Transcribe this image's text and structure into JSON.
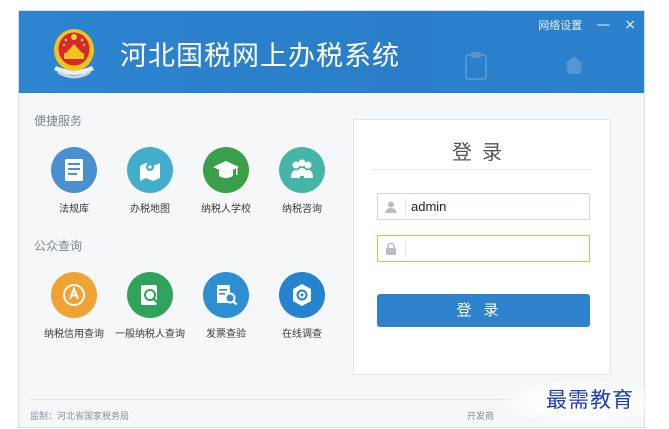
{
  "header": {
    "title": "河北国税网上办税系统",
    "network_settings": "网络设置",
    "minimize": "—",
    "close": "×"
  },
  "sections": {
    "convenience": {
      "title": "便捷服务",
      "items": [
        {
          "label": "法规库",
          "icon": "book-icon",
          "color": "#4a90cf"
        },
        {
          "label": "办税地图",
          "icon": "map-icon",
          "color": "#41aecb"
        },
        {
          "label": "纳税人学校",
          "icon": "graduation-cap-icon",
          "color": "#3b9e49"
        },
        {
          "label": "纳税咨询",
          "icon": "people-consult-icon",
          "color": "#45b6a6"
        }
      ]
    },
    "public_query": {
      "title": "公众查询",
      "items": [
        {
          "label": "纳税信用查询",
          "icon": "credit-badge-icon",
          "color": "#f0a233"
        },
        {
          "label": "一般纳税人查询",
          "icon": "person-search-icon",
          "color": "#2fa35a"
        },
        {
          "label": "发票查验",
          "icon": "invoice-search-icon",
          "color": "#2d8ed2"
        },
        {
          "label": "在线调查",
          "icon": "survey-icon",
          "color": "#2583cf"
        }
      ]
    }
  },
  "login": {
    "title": "登录",
    "username": "admin",
    "password": "",
    "button": "登录"
  },
  "footer": {
    "supervisor": "监制：河北省国家税务局",
    "developer": "开发商"
  },
  "watermark": "最需教育"
}
